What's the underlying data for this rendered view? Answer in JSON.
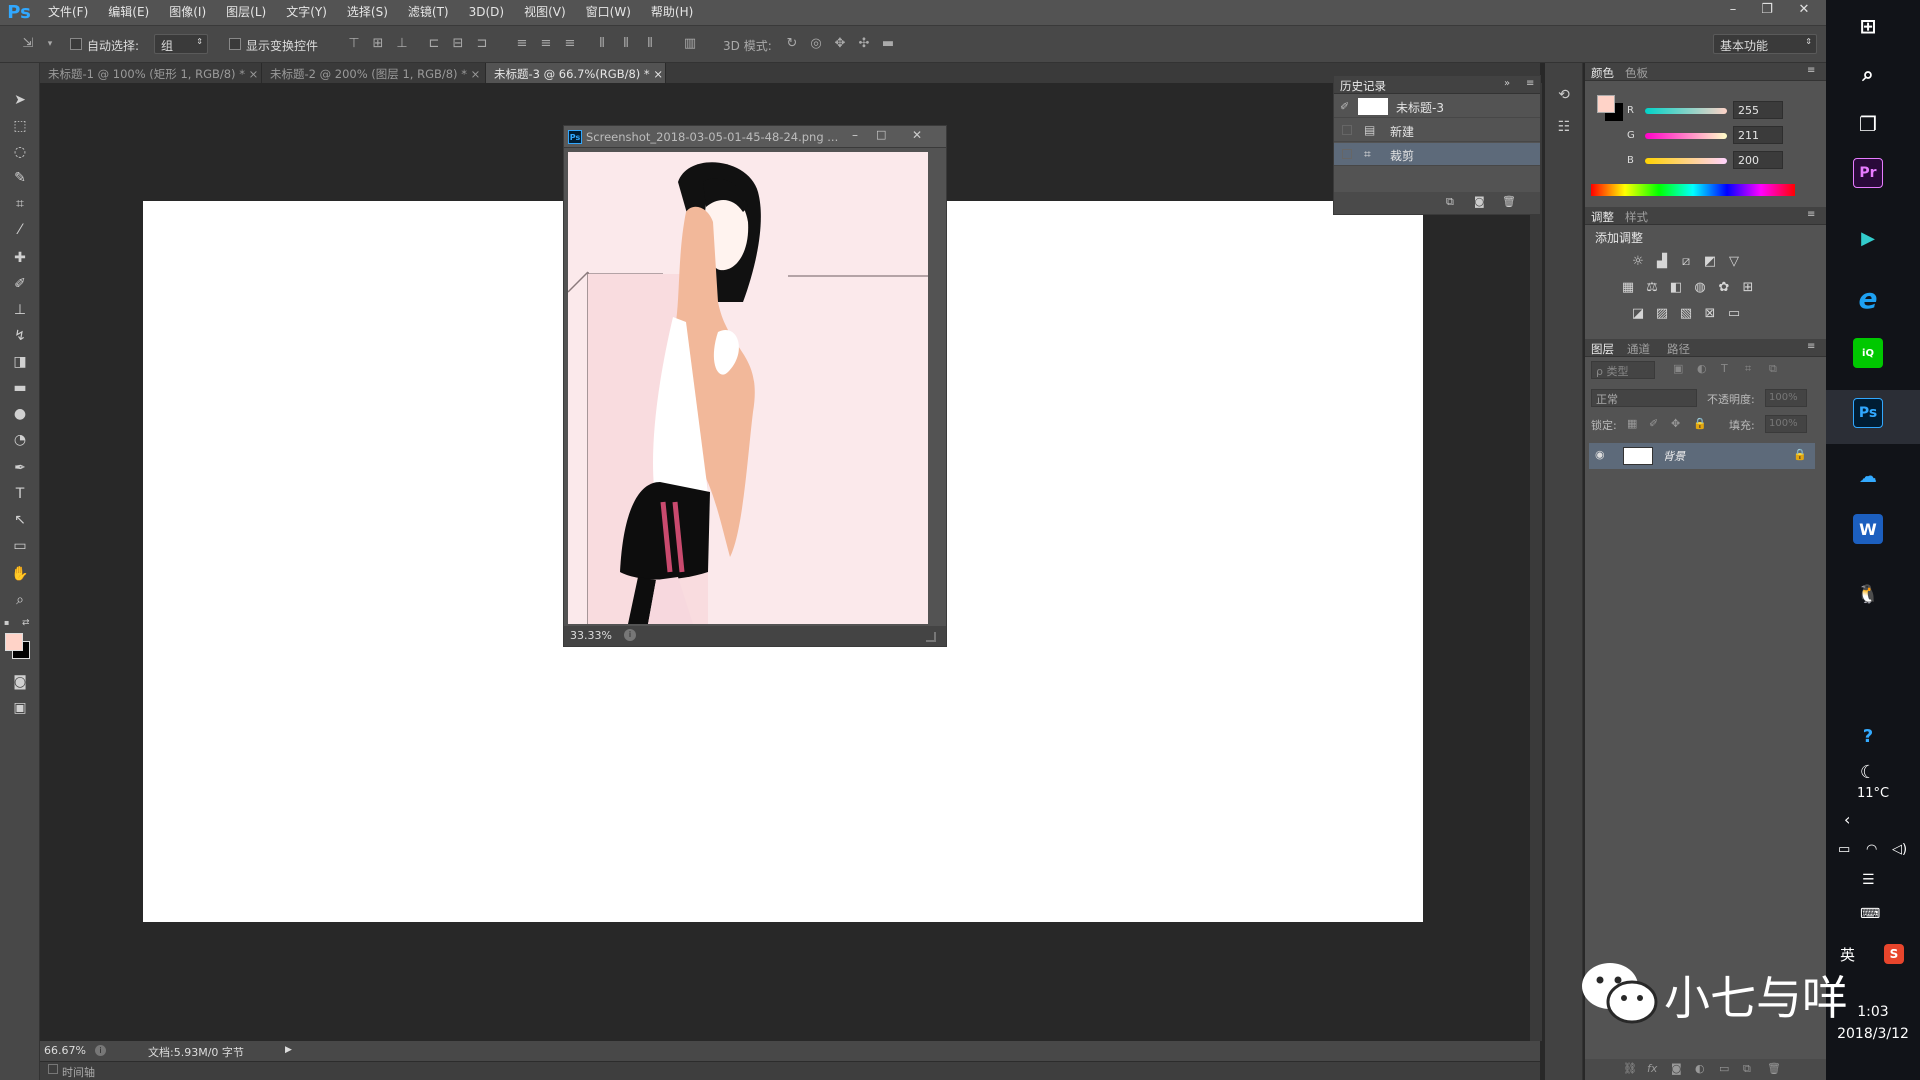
{
  "app": {
    "logo": "Ps"
  },
  "menu": [
    "文件(F)",
    "编辑(E)",
    "图像(I)",
    "图层(L)",
    "文字(Y)",
    "选择(S)",
    "滤镜(T)",
    "3D(D)",
    "视图(V)",
    "窗口(W)",
    "帮助(H)"
  ],
  "window_controls": {
    "minimize": "–",
    "restore": "❐",
    "close": "✕"
  },
  "options": {
    "auto_select_label": "自动选择:",
    "auto_select_value": "组",
    "show_transform_label": "显示变换控件",
    "mode_3d_label": "3D 模式:",
    "workspace": "基本功能"
  },
  "tabs": [
    {
      "label": "未标题-1 @ 100% (矩形 1, RGB/8) *",
      "close": "×"
    },
    {
      "label": "未标题-2 @ 200% (图层 1, RGB/8) *",
      "close": "×"
    },
    {
      "label": "未标题-3 @ 66.7%(RGB/8) *",
      "close": "×"
    }
  ],
  "float_window": {
    "icon": "Ps",
    "title": "Screenshot_2018-03-05-01-45-48-24.png ...",
    "zoom": "33.33%"
  },
  "status": {
    "zoom": "66.67%",
    "doc": "文档:5.93M/0 字节",
    "timeline": "时间轴"
  },
  "history": {
    "title": "历史记录",
    "snapshot": "未标题-3",
    "items": [
      "新建",
      "裁剪"
    ]
  },
  "color_panel": {
    "tabs": [
      "颜色",
      "色板"
    ],
    "channels": [
      {
        "label": "R",
        "value": "255"
      },
      {
        "label": "G",
        "value": "211"
      },
      {
        "label": "B",
        "value": "200"
      }
    ],
    "foreground": "#ffd3c8",
    "background": "#000000"
  },
  "adjust_panel": {
    "tabs": [
      "调整",
      "样式"
    ],
    "add_label": "添加调整"
  },
  "layers_panel": {
    "tabs": [
      "图层",
      "通道",
      "路径"
    ],
    "filter": "ρ 类型",
    "blend": "正常",
    "opacity_label": "不透明度:",
    "opacity_value": "100%",
    "lock_label": "锁定:",
    "fill_label": "填充:",
    "fill_value": "100%",
    "layer_name": "背景"
  },
  "taskbar": {
    "weather_temp": "11°C",
    "ime": "英",
    "time": "1:03",
    "date": "2018/3/12",
    "apps": [
      "Pr",
      "Ps",
      "W"
    ]
  },
  "watermark": "小七与咩"
}
